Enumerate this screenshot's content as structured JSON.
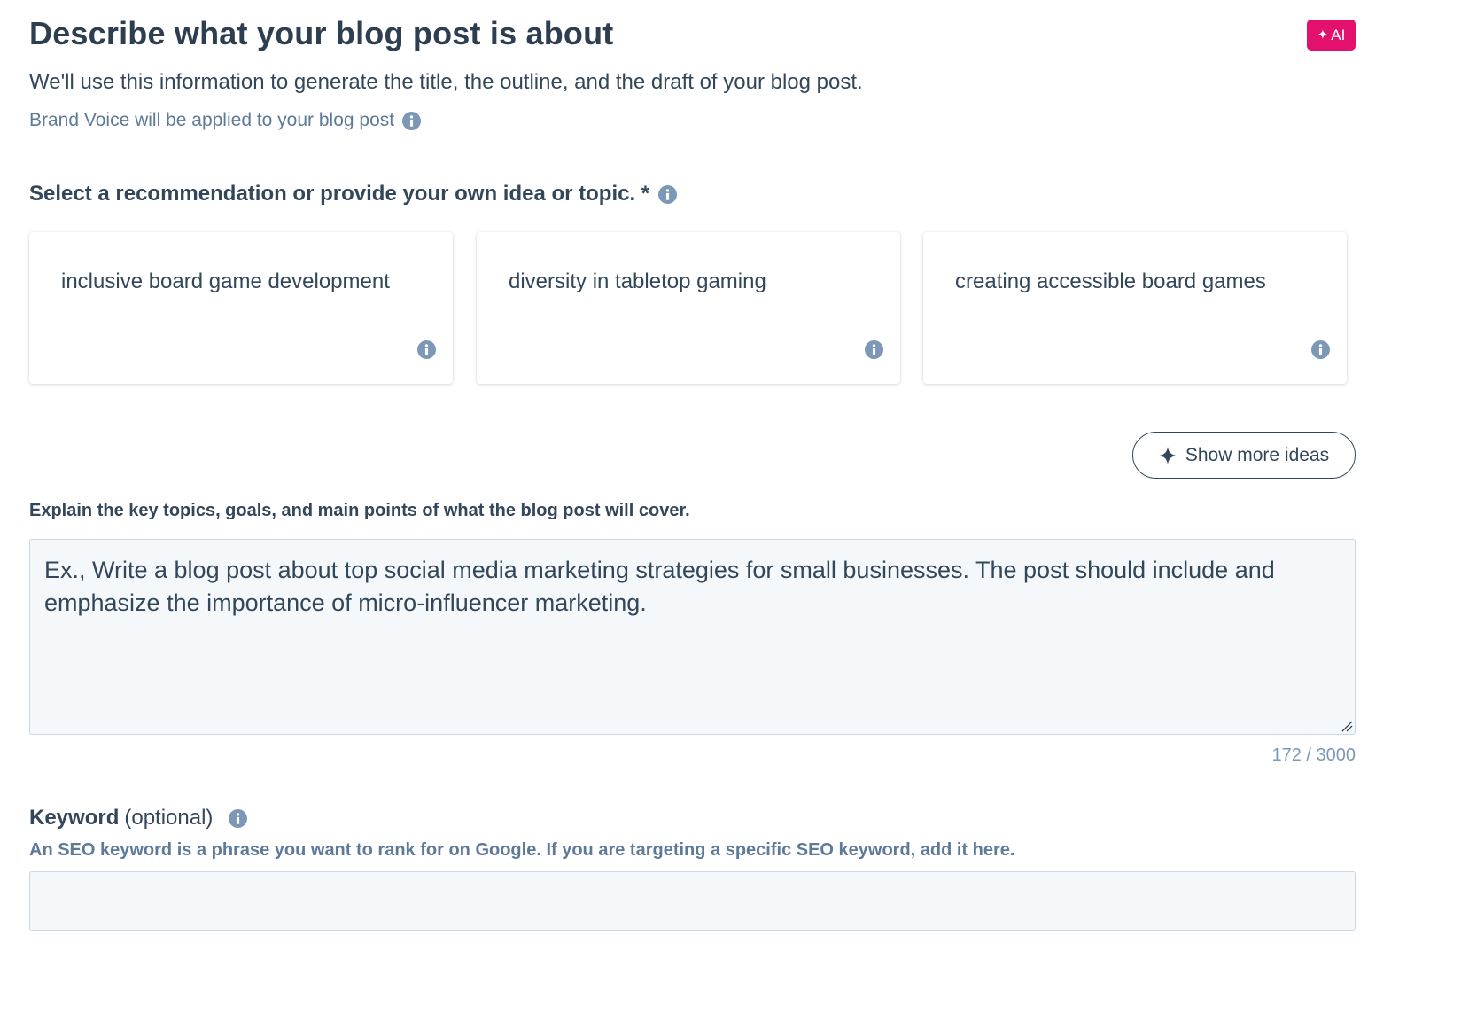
{
  "header": {
    "title": "Describe what your blog post is about",
    "ai_badge": "AI",
    "subtitle": "We'll use this information to generate the title, the outline, and the draft of your blog post.",
    "brand_voice": "Brand Voice will be applied to your blog post"
  },
  "recommendations": {
    "label": "Select a recommendation or provide your own idea or topic. *",
    "cards": [
      {
        "text": "inclusive board game development"
      },
      {
        "text": "diversity in tabletop gaming"
      },
      {
        "text": "creating accessible board games"
      }
    ],
    "show_more_label": "Show more ideas"
  },
  "explain": {
    "label": "Explain the key topics, goals, and main points of what the blog post will cover.",
    "value": "Ex., Write a blog post about top social media marketing strategies for small businesses. The post should include and emphasize the importance of micro-influencer marketing.",
    "char_count": "172 / 3000"
  },
  "keyword": {
    "label": "Keyword",
    "optional": "(optional)",
    "help": "An SEO keyword is a phrase you want to rank for on Google. If you are targeting a specific SEO keyword, add it here.",
    "value": "",
    "placeholder": ""
  },
  "colors": {
    "accent_pink": "#e3106e",
    "text_dark": "#33475b",
    "text_muted": "#5e7a99",
    "info_icon": "#7c98b6",
    "input_bg": "#f5f8fa",
    "input_border": "#cbd6e2"
  },
  "icons": {
    "info": "info-circle-icon",
    "sparkle": "sparkle-icon",
    "resize": "resize-handle-icon"
  }
}
